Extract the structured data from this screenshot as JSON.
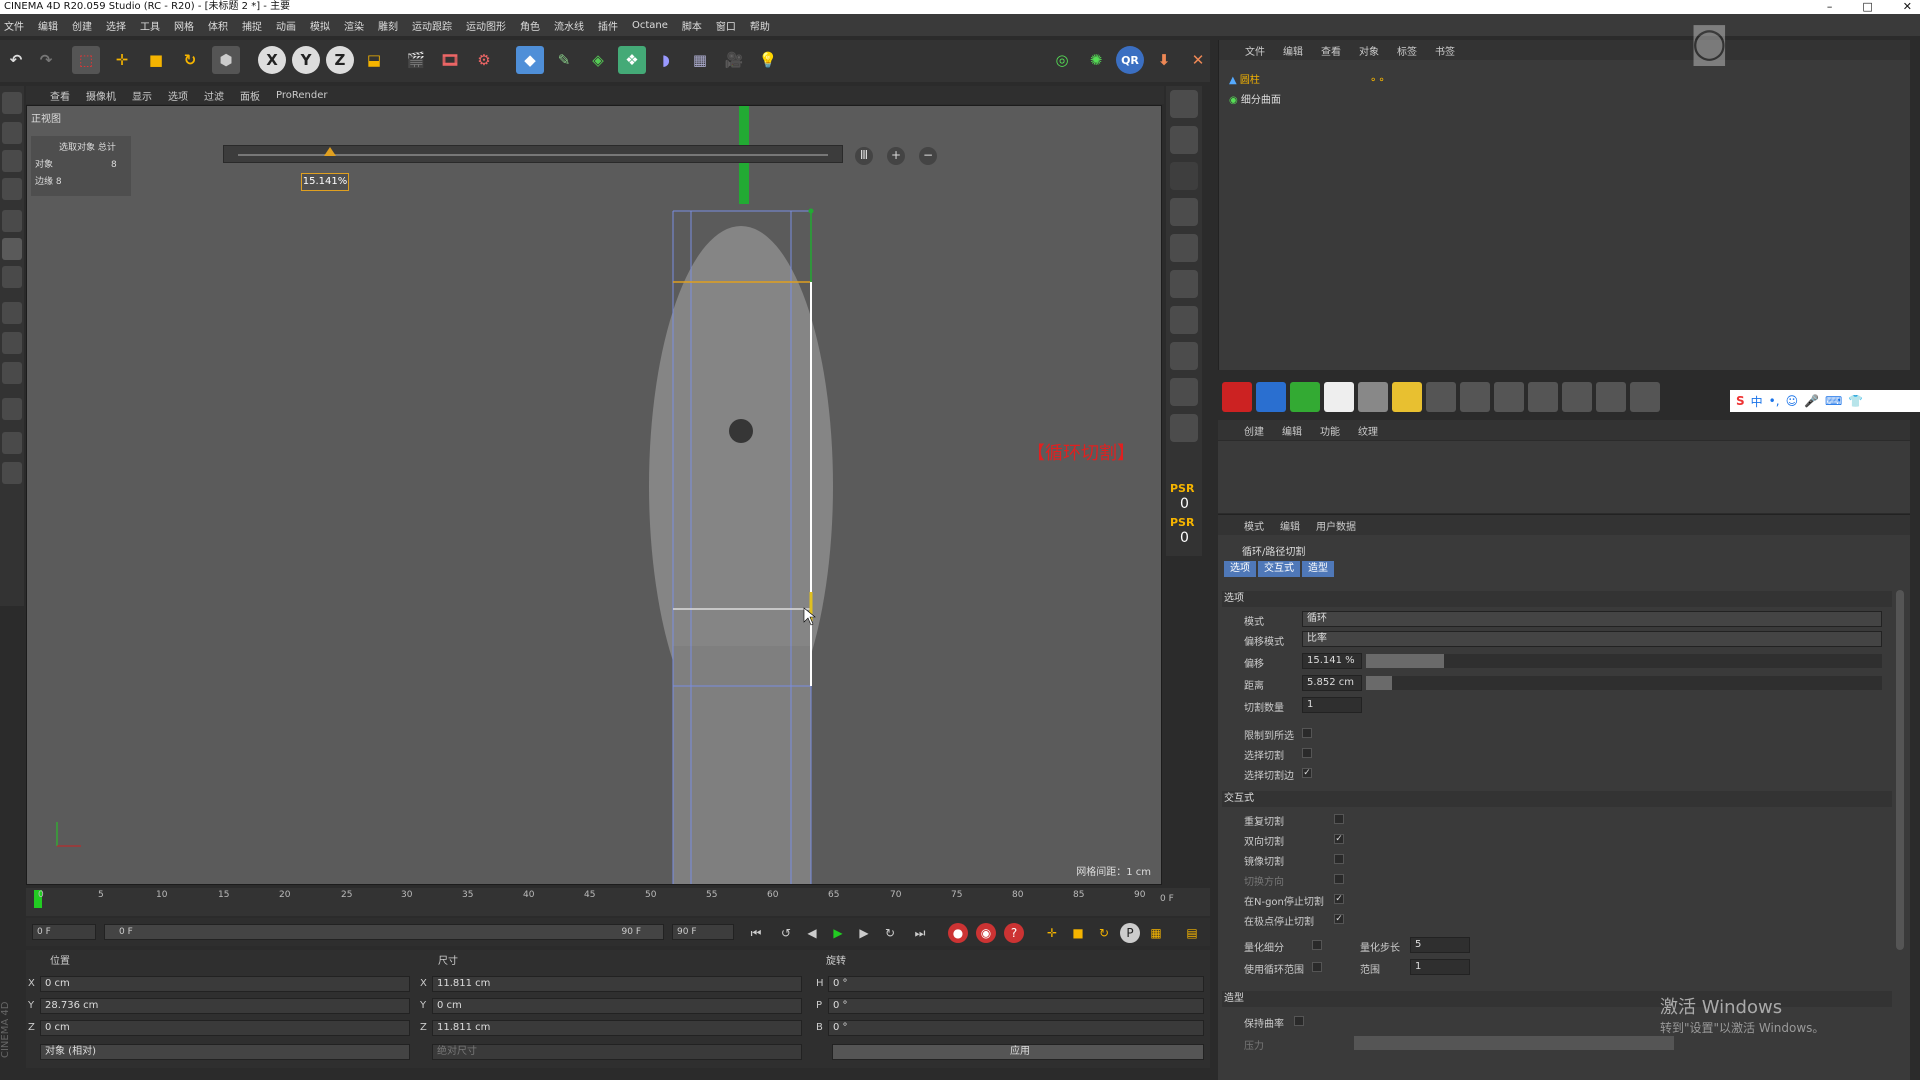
{
  "window": {
    "title": "CINEMA 4D R20.059 Studio (RC - R20) - [未标题 2 *] - 主要"
  },
  "menubar": [
    "文件",
    "编辑",
    "创建",
    "选择",
    "工具",
    "网格",
    "体积",
    "捕捉",
    "动画",
    "模拟",
    "渲染",
    "雕刻",
    "运动跟踪",
    "运动图形",
    "角色",
    "流水线",
    "插件",
    "Octane",
    "脚本",
    "窗口",
    "帮助"
  ],
  "viewport": {
    "menu": [
      "查看",
      "摄像机",
      "显示",
      "选项",
      "过滤",
      "面板",
      "ProRender"
    ],
    "view_name": "正视图",
    "stats": {
      "title": "选取对象 总计",
      "objects_label": "对象",
      "objects_value": "8",
      "edges_label": "边缘",
      "edges_value": "8"
    },
    "slider_value": "15.141%",
    "annotation": "【循环切割】",
    "grid_spacing": "网格间距：1 cm",
    "psr1": "PSR",
    "psr1_value": "0",
    "psr2": "PSR",
    "psr2_value": "0"
  },
  "timeline": {
    "ticks": [
      "0",
      "5",
      "10",
      "15",
      "20",
      "25",
      "30",
      "35",
      "40",
      "45",
      "50",
      "55",
      "60",
      "65",
      "70",
      "75",
      "80",
      "85",
      "90"
    ],
    "end_frame": "0 F",
    "current_frame": "0 F",
    "range_start": "0 F",
    "range_end": "90 F",
    "max_frame": "90 F"
  },
  "coords": {
    "position_header": "位置",
    "size_header": "尺寸",
    "rotation_header": "旋转",
    "pos_x": "0 cm",
    "pos_y": "28.736 cm",
    "pos_z": "0 cm",
    "size_x": "11.811 cm",
    "size_y": "0 cm",
    "size_z": "11.811 cm",
    "rot_h": "0 °",
    "rot_p": "0 °",
    "rot_b": "0 °",
    "mode": "对象 (相对)",
    "size_mode": "绝对尺寸",
    "apply": "应用"
  },
  "object_manager": {
    "menu": [
      "文件",
      "编辑",
      "查看",
      "对象",
      "标签",
      "书签"
    ],
    "objects": [
      "圆柱",
      "细分曲面"
    ]
  },
  "material_manager": {
    "menu": [
      "创建",
      "编辑",
      "功能",
      "纹理"
    ]
  },
  "ime": {
    "text": "中"
  },
  "attributes": {
    "menu": [
      "模式",
      "编辑",
      "用户数据"
    ],
    "tool_title": "循环/路径切割",
    "tabs": [
      "选项",
      "交互式",
      "造型"
    ],
    "section_options": "选项",
    "mode_label": "模式",
    "mode_value": "循环",
    "offset_mode_label": "偏移模式",
    "offset_mode_value": "比率",
    "offset_label": "偏移",
    "offset_value": "15.141 %",
    "offset_fraction": 0.15141,
    "distance_label": "距离",
    "distance_value": "5.852 cm",
    "distance_fraction": 0.05,
    "cuts_label": "切割数量",
    "cuts_value": "1",
    "restrict_label": "限制到所选",
    "select_cut_label": "选择切割",
    "select_edges_label": "选择切割边",
    "section_interactive": "交互式",
    "repeat_label": "重复切割",
    "dual_label": "双向切割",
    "mirror_label": "镜像切割",
    "flip_label": "切换方向",
    "ngon_label": "在N-gon停止切割",
    "boundary_label": "在极点停止切割",
    "quantize_label": "量化细分",
    "quantize_step_label": "量化步长",
    "quantize_step_value": "5",
    "loop_range_label": "使用循环范围",
    "range_label": "范围",
    "range_value": "1",
    "section_shaping": "造型",
    "keep_curvature_label": "保持曲率",
    "tension_label": "压力"
  },
  "system": {
    "activate_title": "激活 Windows",
    "activate_hint": "转到\"设置\"以激活 Windows。"
  },
  "colors": {
    "accent_blue": "#4f78b8",
    "highlight_orange": "#e0a020",
    "annotation_red": "#e02020",
    "green_axis": "#22aa33"
  }
}
